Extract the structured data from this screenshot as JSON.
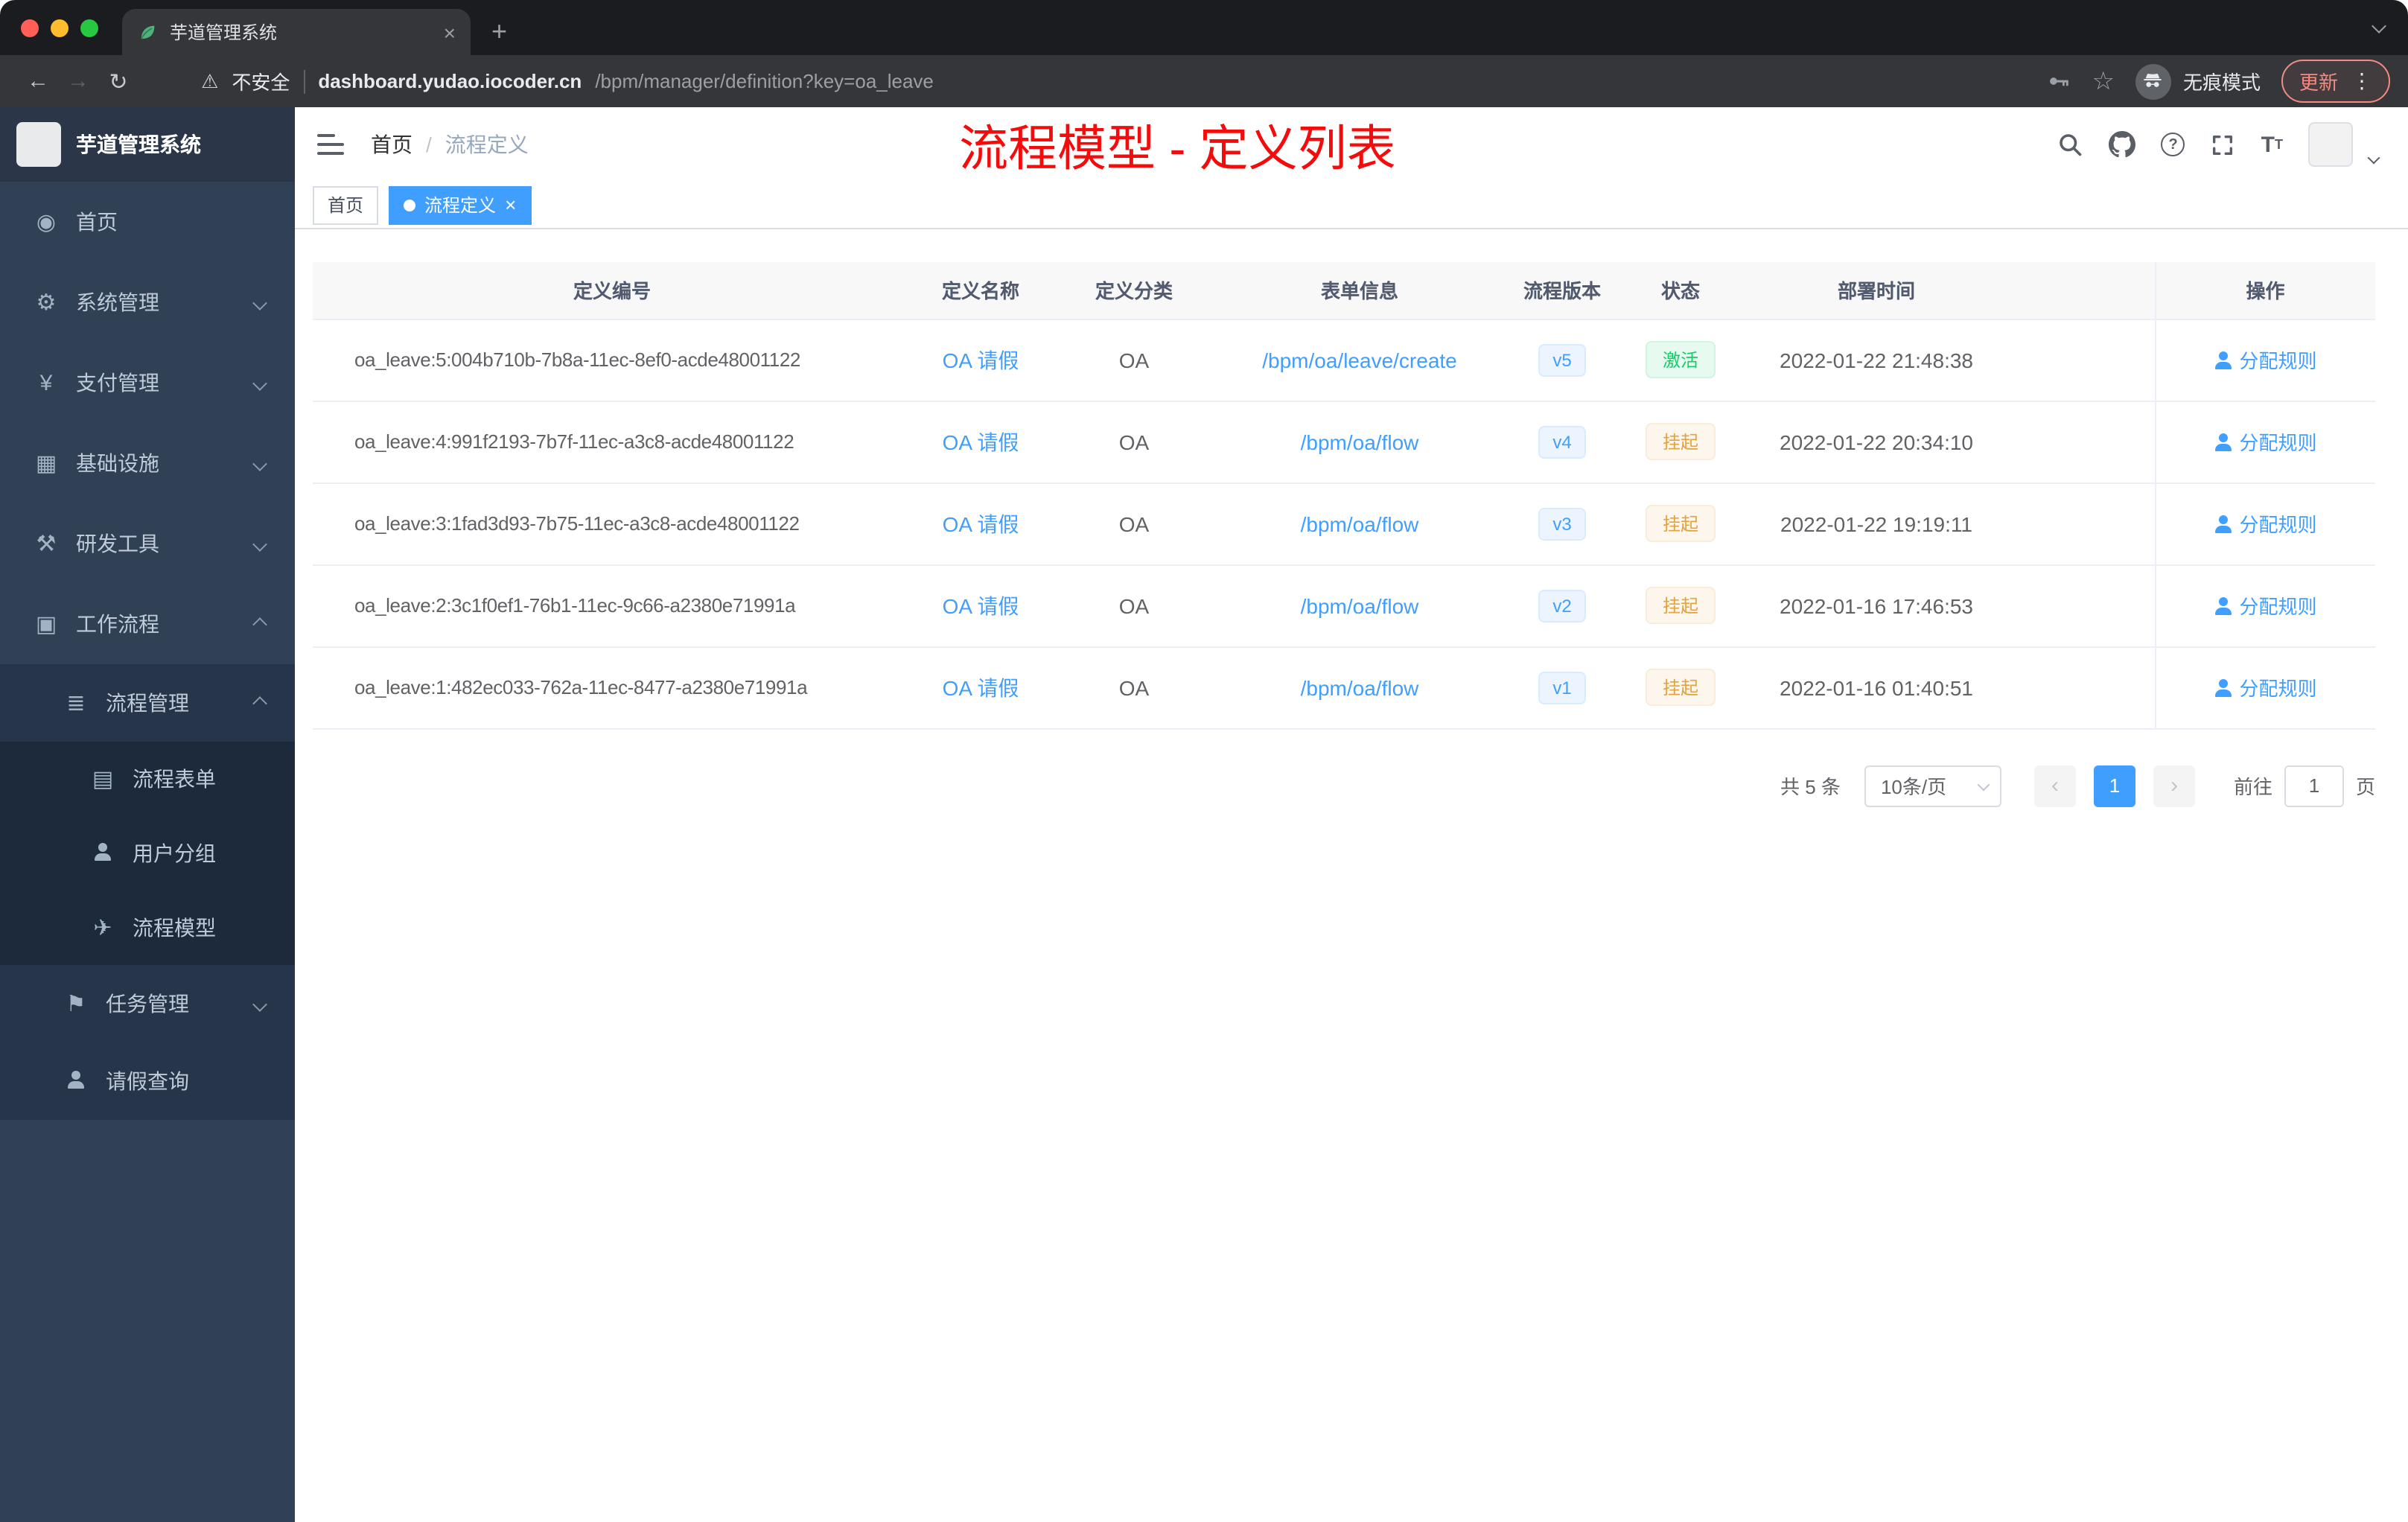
{
  "colors": {
    "accent_blue": "#409eff",
    "annotation_red": "#f40b0b",
    "status_active_green": "#13ce66",
    "status_suspended_yellow": "#e6a23c",
    "sidebar_bg": "#304156",
    "active_tag_bg": "#409eff"
  },
  "icons": {
    "warning": "⚠",
    "back": "←",
    "forward": "→",
    "reload": "↻",
    "star": "☆",
    "more-dots": "⋮",
    "plus": "+",
    "close": "×",
    "home": "◉",
    "gear": "⚙",
    "payment": "¥",
    "infrastructure": "▦",
    "dev-tools": "⚒",
    "workflow": "▣",
    "process-manage": "≣",
    "process-form": "▤",
    "process-model": "✈",
    "task-manage": "⚑"
  },
  "browser": {
    "tab_title": "芋道管理系统",
    "security_label": "不安全",
    "url_domain": "dashboard.yudao.iocoder.cn",
    "url_path": "/bpm/manager/definition?key=oa_leave",
    "incognito_label": "无痕模式",
    "update_label": "更新"
  },
  "sidebar": {
    "brand": "芋道管理系统",
    "items": [
      {
        "label": "首页"
      },
      {
        "label": "系统管理"
      },
      {
        "label": "支付管理"
      },
      {
        "label": "基础设施"
      },
      {
        "label": "研发工具"
      },
      {
        "label": "工作流程"
      },
      {
        "label": "流程管理"
      },
      {
        "label": "流程表单"
      },
      {
        "label": "用户分组"
      },
      {
        "label": "流程模型"
      },
      {
        "label": "任务管理"
      },
      {
        "label": "请假查询"
      }
    ]
  },
  "header": {
    "breadcrumb_home": "首页",
    "breadcrumb_sep": "/",
    "breadcrumb_current": "流程定义",
    "annotation": "流程模型 - 定义列表"
  },
  "tags": {
    "home": "首页",
    "current": "流程定义"
  },
  "table": {
    "headers": [
      "定义编号",
      "定义名称",
      "定义分类",
      "表单信息",
      "流程版本",
      "状态",
      "部署时间",
      "操作"
    ],
    "rows": [
      {
        "id": "oa_leave:5:004b710b-7b8a-11ec-8ef0-acde48001122",
        "name": "OA 请假",
        "category": "OA",
        "form": "/bpm/oa/leave/create",
        "version": "v5",
        "status": "激活",
        "deploy_time": "2022-01-22 21:48:38",
        "action": "分配规则"
      },
      {
        "id": "oa_leave:4:991f2193-7b7f-11ec-a3c8-acde48001122",
        "name": "OA 请假",
        "category": "OA",
        "form": "/bpm/oa/flow",
        "version": "v4",
        "status": "挂起",
        "deploy_time": "2022-01-22 20:34:10",
        "action": "分配规则"
      },
      {
        "id": "oa_leave:3:1fad3d93-7b75-11ec-a3c8-acde48001122",
        "name": "OA 请假",
        "category": "OA",
        "form": "/bpm/oa/flow",
        "version": "v3",
        "status": "挂起",
        "deploy_time": "2022-01-22 19:19:11",
        "action": "分配规则"
      },
      {
        "id": "oa_leave:2:3c1f0ef1-76b1-11ec-9c66-a2380e71991a",
        "name": "OA 请假",
        "category": "OA",
        "form": "/bpm/oa/flow",
        "version": "v2",
        "status": "挂起",
        "deploy_time": "2022-01-16 17:46:53",
        "action": "分配规则"
      },
      {
        "id": "oa_leave:1:482ec033-762a-11ec-8477-a2380e71991a",
        "name": "OA 请假",
        "category": "OA",
        "form": "/bpm/oa/flow",
        "version": "v1",
        "status": "挂起",
        "deploy_time": "2022-01-16 01:40:51",
        "action": "分配规则"
      }
    ]
  },
  "pagination": {
    "total": "共 5 条",
    "page_size": "10条/页",
    "current_page": "1",
    "goto_label": "前往",
    "goto_value": "1",
    "page_unit": "页"
  }
}
